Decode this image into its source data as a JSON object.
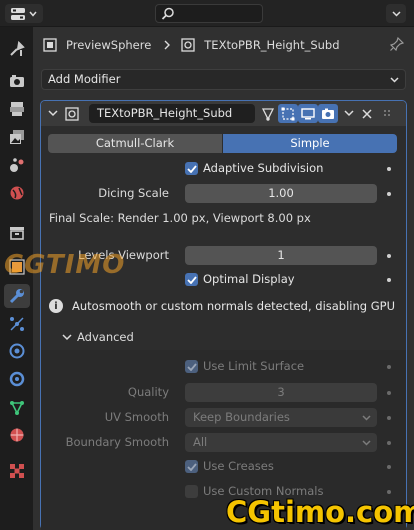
{
  "breadcrumb": {
    "object": "PreviewSphere",
    "modifier": "TEXtoPBR_Height_Subd"
  },
  "add_modifier": {
    "label": "Add Modifier"
  },
  "modifier": {
    "name": "TEXtoPBR_Height_Subd",
    "mode_tabs": [
      "Catmull-Clark",
      "Simple"
    ],
    "selected_mode": "Simple",
    "adaptive_subdivision": {
      "label": "Adaptive Subdivision",
      "checked": true
    },
    "dicing_scale": {
      "label": "Dicing Scale",
      "value": "1.00"
    },
    "final_scale": "Final Scale: Render 1.00 px, Viewport 8.00 px",
    "levels_viewport": {
      "label": "Levels Viewport",
      "value": "1"
    },
    "optimal_display": {
      "label": "Optimal Display",
      "checked": true
    },
    "warning": "Autosmooth or custom normals detected, disabling GPU subdi...",
    "advanced": {
      "title": "Advanced",
      "use_limit_surface": {
        "label": "Use Limit Surface",
        "checked": true
      },
      "quality": {
        "label": "Quality",
        "value": "3"
      },
      "uv_smooth": {
        "label": "UV Smooth",
        "value": "Keep Boundaries"
      },
      "boundary_smooth": {
        "label": "Boundary Smooth",
        "value": "All"
      },
      "use_creases": {
        "label": "Use Creases",
        "checked": true
      },
      "use_custom_normals": {
        "label": "Use Custom Normals",
        "checked": false
      }
    }
  },
  "watermarks": {
    "top": "CGTIMO",
    "bottom": "CGtimo.com"
  },
  "colors": {
    "accent": "#4772b3",
    "panel": "#303030",
    "tabbar": "#1d1d1d"
  }
}
